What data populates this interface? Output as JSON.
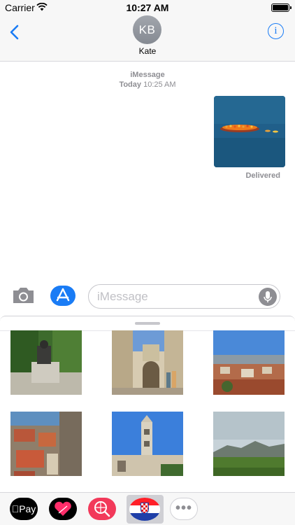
{
  "status_bar": {
    "carrier": "Carrier",
    "time": "10:27 AM",
    "wifi_icon": "wifi-icon",
    "battery_icon": "battery-icon"
  },
  "header": {
    "back_icon": "chevron-left-icon",
    "avatar_initials": "KB",
    "contact_name": "Kate",
    "info_icon": "info-icon",
    "info_glyph": "i"
  },
  "conversation": {
    "service": "iMessage",
    "timestamp_day": "Today",
    "timestamp_time": "10:25 AM",
    "message_photo": "photo of a crowded refugee boat on open sea",
    "delivery_status": "Delivered"
  },
  "input_bar": {
    "camera_icon": "camera-icon",
    "appstore_icon": "app-store-icon",
    "placeholder": "iMessage",
    "mic_icon": "microphone-icon"
  },
  "sticker_drawer": {
    "stickers": [
      "Statue on stone pedestal among trees",
      "Old town gate in stone walls",
      "City panorama with red rooftops",
      "Aerial view of old town rooftops",
      "Cathedral bell tower under blue sky",
      "Green valley with distant mountains"
    ]
  },
  "app_tray": {
    "apple_pay_label": "Pay",
    "apps": [
      "apple-pay-app",
      "digital-touch-heart-app",
      "image-search-app",
      "croatia-flag-sticker-app",
      "more-apps"
    ],
    "more_label": "•••"
  },
  "colors": {
    "accent": "#1a7cf5",
    "header_bg": "#f7f7f7",
    "secondary_text": "#8e8e93",
    "search_app": "#f2395a"
  }
}
